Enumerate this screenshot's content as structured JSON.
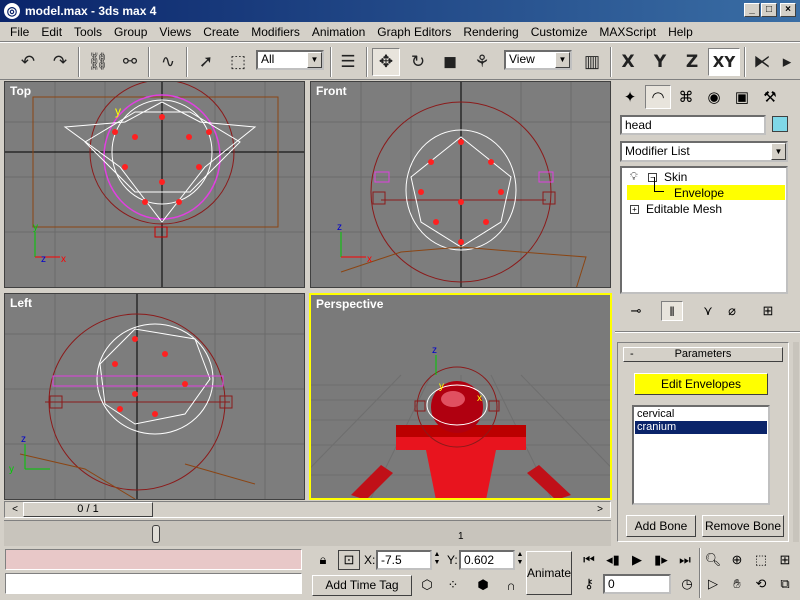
{
  "window": {
    "title": "model.max - 3ds max 4"
  },
  "menu": [
    "File",
    "Edit",
    "Tools",
    "Group",
    "Views",
    "Create",
    "Modifiers",
    "Animation",
    "Graph Editors",
    "Rendering",
    "Customize",
    "MAXScript",
    "Help"
  ],
  "toolbar": {
    "selection_filter": "All",
    "ref_coord": "View",
    "axis_x": "X",
    "axis_y": "Y",
    "axis_z": "Z",
    "axis_xy": "XY"
  },
  "viewports": {
    "top": "Top",
    "front": "Front",
    "left": "Left",
    "perspective": "Perspective"
  },
  "command_panel": {
    "object_name": "head",
    "modifier_list": "Modifier List",
    "stack": {
      "skin": "Skin",
      "envelope": "Envelope",
      "editable_mesh": "Editable Mesh"
    },
    "rollout_title": "Parameters",
    "rollout_toggle": "-",
    "edit_envelopes": "Edit Envelopes",
    "bones": [
      "cervical",
      "cranium"
    ],
    "add_bone": "Add Bone",
    "remove_bone": "Remove Bone"
  },
  "timeline": {
    "frame_display": "0 / 1",
    "track_mark": "1"
  },
  "status": {
    "x_label": "X:",
    "x_value": "-7.5",
    "y_label": "Y:",
    "y_value": "0.602",
    "animate": "Animate",
    "add_time_tag": "Add Time Tag",
    "current_frame": "0"
  },
  "colors": {
    "viewport_bg": "#7d7d7d",
    "active_border": "#ffff00",
    "highlight": "#ffff00",
    "selection": "#0a246a"
  }
}
